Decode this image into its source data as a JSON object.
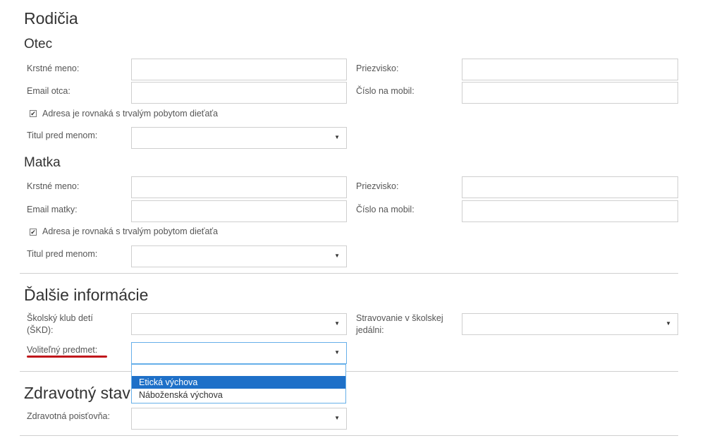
{
  "sections": {
    "parents_title": "Rodičia",
    "father": {
      "title": "Otec",
      "first_name_label": "Krstné meno:",
      "surname_label": "Priezvisko:",
      "email_label": "Email otca:",
      "mobile_label": "Číslo na mobil:",
      "same_address_label": "Adresa je rovnaká s trvalým pobytom dieťaťa",
      "title_label": "Titul pred menom:"
    },
    "mother": {
      "title": "Matka",
      "first_name_label": "Krstné meno:",
      "surname_label": "Priezvisko:",
      "email_label": "Email matky:",
      "mobile_label": "Číslo na mobil:",
      "same_address_label": "Adresa je rovnaká s trvalým pobytom dieťaťa",
      "title_label": "Titul pred menom:"
    },
    "more_info": {
      "title": "Ďalšie informácie",
      "club_label_line1": "Školský klub detí",
      "club_label_line2": "(ŠKD):",
      "canteen_label_line1": "Stravovanie v školskej",
      "canteen_label_line2": "jedálni:",
      "elective_label": "Voliteľný predmet:",
      "elective_options": [
        "",
        "Etická výchova",
        "Náboženská výchova"
      ]
    },
    "health": {
      "title_visible": "Zdravotný stav",
      "insurance_label": "Zdravotná poisťovňa:"
    }
  },
  "colors": {
    "focus_border": "#66afe9",
    "selected_option_bg": "#1e70c8",
    "annotation_underline": "#c0161b"
  }
}
